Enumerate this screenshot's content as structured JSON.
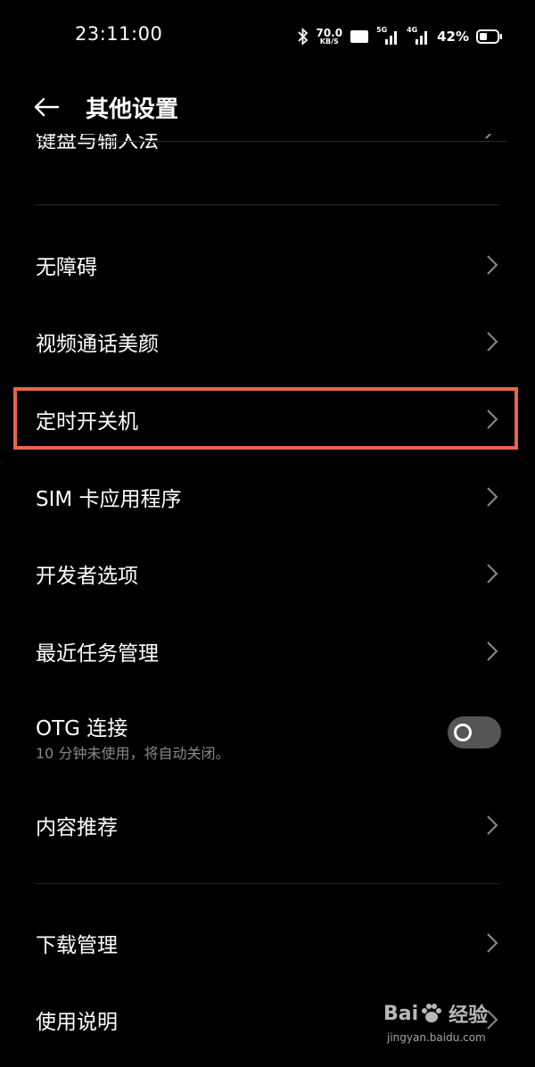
{
  "status_bar": {
    "time": "23:11:00",
    "speed_value": "70.0",
    "speed_unit": "KB/S",
    "hd_label": "HD",
    "net1_label": "5G",
    "net2_label": "4G",
    "battery_percent": "42%"
  },
  "header": {
    "title": "其他设置"
  },
  "clipped_item": {
    "label": "键盘与输入法"
  },
  "items": [
    {
      "label": "无障碍"
    },
    {
      "label": "视频通话美颜"
    },
    {
      "label": "定时开关机"
    },
    {
      "label": "SIM 卡应用程序"
    },
    {
      "label": "开发者选项"
    },
    {
      "label": "最近任务管理"
    },
    {
      "label": "OTG 连接",
      "subtitle": "10 分钟未使用，将自动关闭。",
      "toggle_on": false
    },
    {
      "label": "内容推荐"
    },
    {
      "label": "下载管理"
    },
    {
      "label": "使用说明"
    }
  ],
  "highlight_color": "#e8654a",
  "watermark": {
    "brand_left": "Bai",
    "brand_right": "经验",
    "url": "jingyan.baidu.com"
  }
}
